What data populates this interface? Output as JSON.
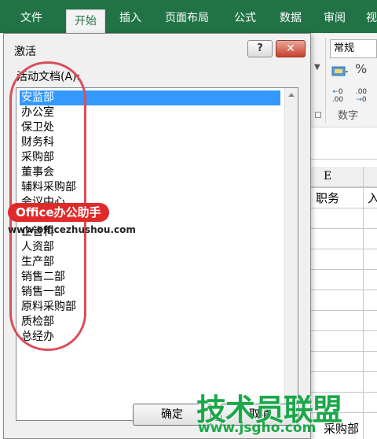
{
  "ribbon": {
    "tabs": [
      "文件",
      "开始",
      "插入",
      "页面布局",
      "公式",
      "数据",
      "审阅",
      "视"
    ],
    "active_tab": "开始",
    "number_format": "常规",
    "percent_symbol": "%",
    "decimal_increase": "←0\n.00",
    "decimal_decrease": ".00\n→0",
    "group_label": "数字"
  },
  "sheet": {
    "column_letter": "E",
    "header_cell": "职务",
    "next_header_partial": "入",
    "bottom_cell": "采购部"
  },
  "dialog": {
    "title": "激活",
    "help_label": "?",
    "close_label": "✕",
    "list_label": "活动文档(A):",
    "items": [
      "安监部",
      "办公室",
      "保卫处",
      "财务科",
      "采购部",
      "董事会",
      "辅料采购部",
      "会议中心",
      "企管科",
      "人资部",
      "生产部",
      "销售二部",
      "销售一部",
      "原料采购部",
      "质检部",
      "总经办"
    ],
    "selected_index": 0,
    "ok_label": "确定",
    "cancel_label": "取消"
  },
  "watermarks": {
    "badge": "Office办公助手",
    "url": "www.officezhushou.com",
    "brand": "技术员联盟",
    "brand_url": "www.jsgho.com"
  },
  "colors": {
    "ribbon_green": "#217346",
    "selection_blue": "#3399ff",
    "annotation_red": "#d8505a",
    "brand_green": "#1ba84a"
  }
}
